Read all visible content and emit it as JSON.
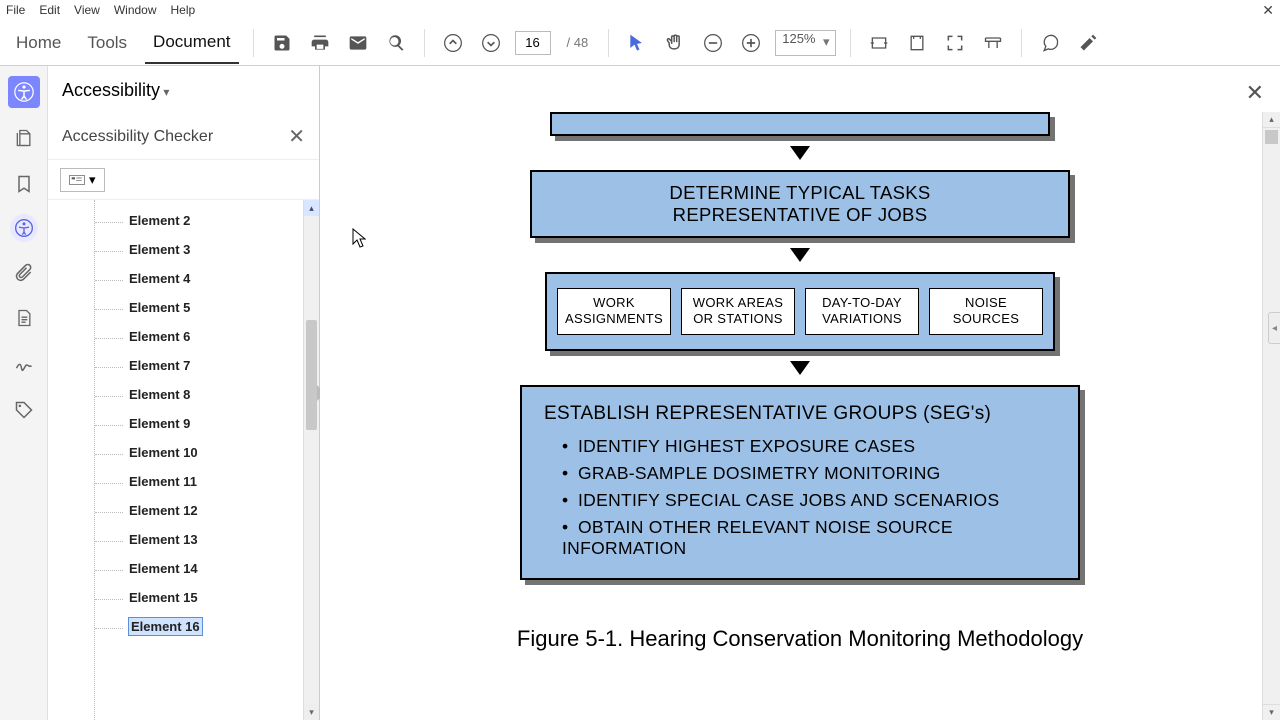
{
  "menu": {
    "items": [
      "File",
      "Edit",
      "View",
      "Window",
      "Help"
    ]
  },
  "tabs": {
    "home": "Home",
    "tools": "Tools",
    "document": "Document"
  },
  "page": {
    "current": "16",
    "total": "48"
  },
  "zoom": {
    "value": "125%"
  },
  "a11y": {
    "title": "Accessibility",
    "checker": "Accessibility Checker"
  },
  "elements": [
    "Element 2",
    "Element 3",
    "Element 4",
    "Element 5",
    "Element 6",
    "Element 7",
    "Element 8",
    "Element 9",
    "Element 10",
    "Element 11",
    "Element 12",
    "Element 13",
    "Element 14",
    "Element 15",
    "Element 16"
  ],
  "flow": {
    "box2a": "DETERMINE TYPICAL TASKS",
    "box2b": "REPRESENTATIVE OF JOBS",
    "m1a": "WORK",
    "m1b": "ASSIGNMENTS",
    "m2a": "WORK AREAS",
    "m2b": "OR STATIONS",
    "m3a": "DAY-TO-DAY",
    "m3b": "VARIATIONS",
    "m4a": "NOISE",
    "m4b": "SOURCES",
    "big_title": "ESTABLISH REPRESENTATIVE GROUPS (SEG's)",
    "b1": "IDENTIFY HIGHEST EXPOSURE CASES",
    "b2": "GRAB-SAMPLE DOSIMETRY MONITORING",
    "b3": "IDENTIFY SPECIAL CASE JOBS AND SCENARIOS",
    "b4": "OBTAIN OTHER RELEVANT NOISE SOURCE INFORMATION"
  },
  "caption": "Figure 5-1. Hearing Conservation Monitoring Methodology"
}
